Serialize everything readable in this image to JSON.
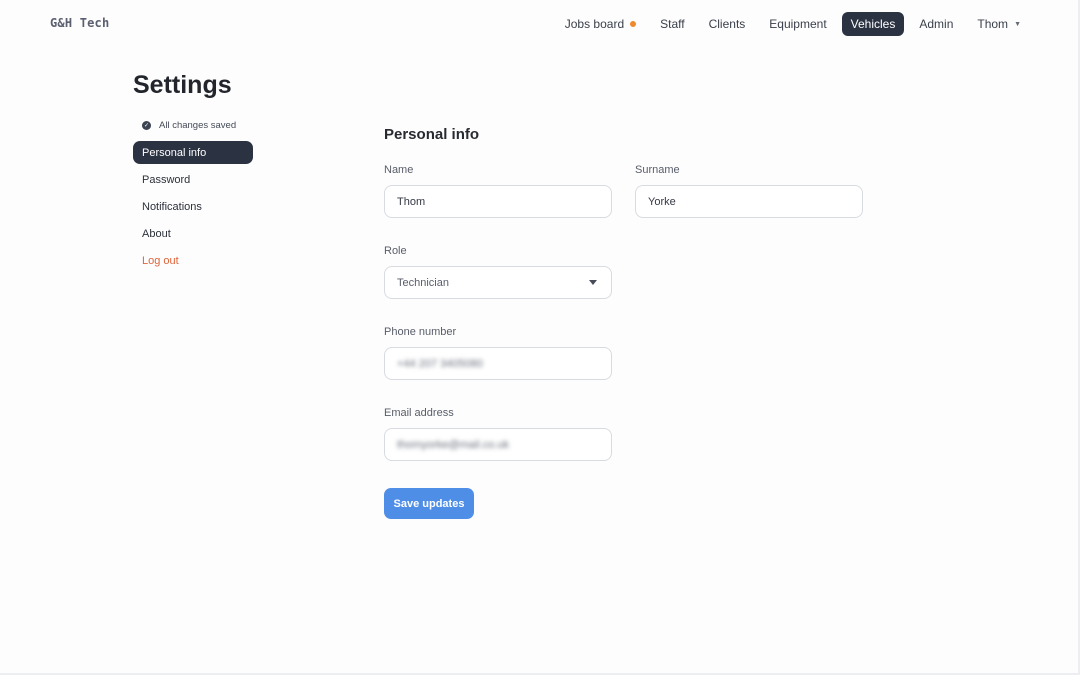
{
  "app": {
    "logo": "G&H Tech"
  },
  "nav": {
    "items": [
      {
        "label": "Jobs board",
        "has_notification_dot": true
      },
      {
        "label": "Staff"
      },
      {
        "label": "Clients"
      },
      {
        "label": "Equipment"
      },
      {
        "label": "Vehicles",
        "active": true
      },
      {
        "label": "Admin"
      }
    ],
    "user_menu": {
      "label": "Thom"
    },
    "notification_color": "#ee8a2d"
  },
  "page": {
    "title": "Settings"
  },
  "sidebar": {
    "status": "All changes saved",
    "items": [
      {
        "label": "Personal info",
        "active": true
      },
      {
        "label": "Password"
      },
      {
        "label": "Notifications"
      },
      {
        "label": "About"
      },
      {
        "label": "Log out",
        "danger": true
      }
    ]
  },
  "form": {
    "section_title": "Personal info",
    "name": {
      "label": "Name",
      "value": "Thom"
    },
    "surname": {
      "label": "Surname",
      "value": "Yorke"
    },
    "role": {
      "label": "Role",
      "selected": "Technician"
    },
    "phone": {
      "label": "Phone number",
      "value": "+44 207 3405080",
      "blurred": true
    },
    "email": {
      "label": "Email address",
      "value": "thomyorke@mail.co.uk",
      "blurred": true
    },
    "save_label": "Save updates"
  },
  "colors": {
    "accent": "#4f8ee6",
    "dark": "#2b3242",
    "danger": "#e0643c"
  }
}
